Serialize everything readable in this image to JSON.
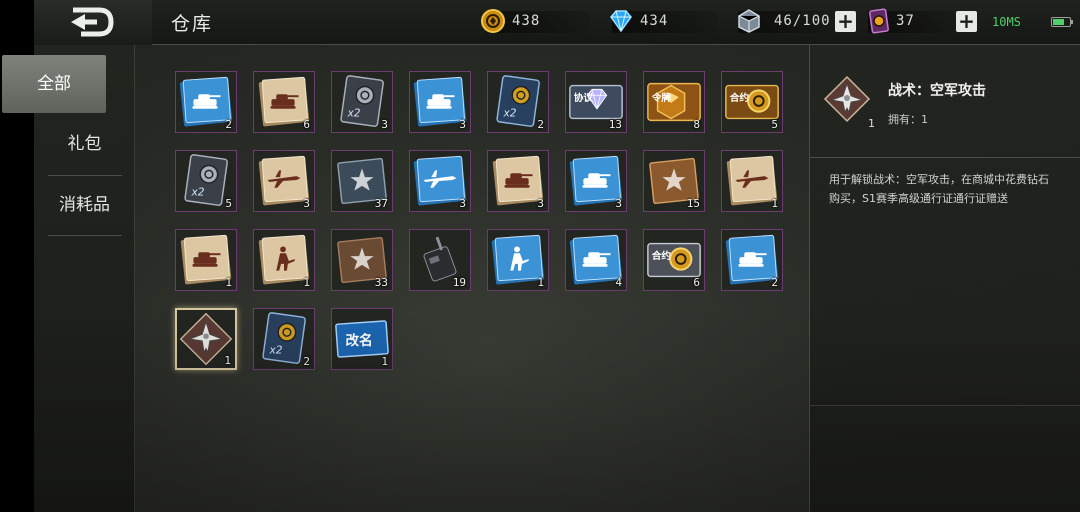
{
  "header": {
    "title": "仓库",
    "back_icon": "back-arrow-icon"
  },
  "resources": {
    "gold": {
      "value": "438",
      "icon": "gold-coin-icon"
    },
    "diamond": {
      "value": "434",
      "icon": "diamond-icon"
    },
    "energy": {
      "value": "46/100",
      "icon": "crystal-cube-icon"
    },
    "ticket": {
      "value": "37",
      "icon": "card-ticket-icon"
    }
  },
  "status": {
    "ping": "10MS"
  },
  "sidebar": {
    "tabs": [
      {
        "label": "全部",
        "active": true
      },
      {
        "label": "礼包",
        "active": false
      },
      {
        "label": "消耗品",
        "active": false
      }
    ]
  },
  "items": [
    {
      "name": "blue-tank-card",
      "count": "2",
      "style": "blue",
      "emblem": "tank"
    },
    {
      "name": "paper-tank-card",
      "count": "6",
      "style": "paper",
      "emblem": "tank"
    },
    {
      "name": "silver-x2-card",
      "count": "3",
      "style": "silverx2",
      "emblem": "x2"
    },
    {
      "name": "blue-tank-card",
      "count": "3",
      "style": "blue",
      "emblem": "tank"
    },
    {
      "name": "gold-x2-card",
      "count": "2",
      "style": "goldx2",
      "emblem": "x2"
    },
    {
      "name": "diamond-protocol",
      "count": "13",
      "style": "protocol",
      "emblem": "diamond",
      "label": "协议"
    },
    {
      "name": "gold-safe-card",
      "count": "8",
      "style": "goldcard",
      "emblem": "gold",
      "label": "令牌"
    },
    {
      "name": "gold-contract",
      "count": "5",
      "style": "contract",
      "emblem": "coin",
      "label": "合约"
    },
    {
      "name": "silver-x2-card",
      "count": "5",
      "style": "silverx2",
      "emblem": "x2"
    },
    {
      "name": "paper-plane-card",
      "count": "3",
      "style": "paper",
      "emblem": "plane"
    },
    {
      "name": "steel-star-book",
      "count": "37",
      "style": "steelbook",
      "emblem": "star"
    },
    {
      "name": "blue-plane-card",
      "count": "3",
      "style": "blue",
      "emblem": "plane"
    },
    {
      "name": "paper-tank-card",
      "count": "3",
      "style": "paper",
      "emblem": "tank"
    },
    {
      "name": "blue-tank-card",
      "count": "3",
      "style": "blue",
      "emblem": "tank"
    },
    {
      "name": "bronze-star-book",
      "count": "15",
      "style": "bronzebook",
      "emblem": "star"
    },
    {
      "name": "paper-plane-card",
      "count": "1",
      "style": "paper",
      "emblem": "plane"
    },
    {
      "name": "paper-tank-card",
      "count": "1",
      "style": "paper",
      "emblem": "tank"
    },
    {
      "name": "paper-soldier-card",
      "count": "1",
      "style": "paper",
      "emblem": "soldier"
    },
    {
      "name": "brown-star-book",
      "count": "33",
      "style": "brownbook",
      "emblem": "star"
    },
    {
      "name": "walkie-talkie",
      "count": "19",
      "style": "radio",
      "emblem": "radio"
    },
    {
      "name": "blue-soldier-card",
      "count": "1",
      "style": "blue",
      "emblem": "soldier"
    },
    {
      "name": "blue-tank-card",
      "count": "4",
      "style": "blue",
      "emblem": "tank"
    },
    {
      "name": "silver-contract",
      "count": "6",
      "style": "contract2",
      "emblem": "coin",
      "label": "合约"
    },
    {
      "name": "blue-tank-card",
      "count": "2",
      "style": "blue",
      "emblem": "tank"
    },
    {
      "name": "airstrike-tactic",
      "count": "1",
      "style": "tactic",
      "emblem": "jet",
      "selected": true
    },
    {
      "name": "gold-x2-card",
      "count": "2",
      "style": "goldx2",
      "emblem": "x2"
    },
    {
      "name": "rename-card",
      "count": "1",
      "style": "rename",
      "emblem": "rename",
      "label": "改名"
    }
  ],
  "detail": {
    "name": "战术：空军攻击",
    "owned": "拥有：1",
    "count": "1",
    "description": "用于解锁战术：空军攻击，在商城中花费钻石购买，S1赛季高级通行证通行证赠送"
  },
  "colors": {
    "item_border": "#6a3d6e",
    "ping_green": "#4fd06a",
    "card_blue": "#2e7cc0",
    "card_paper": "#d8c4a0"
  }
}
